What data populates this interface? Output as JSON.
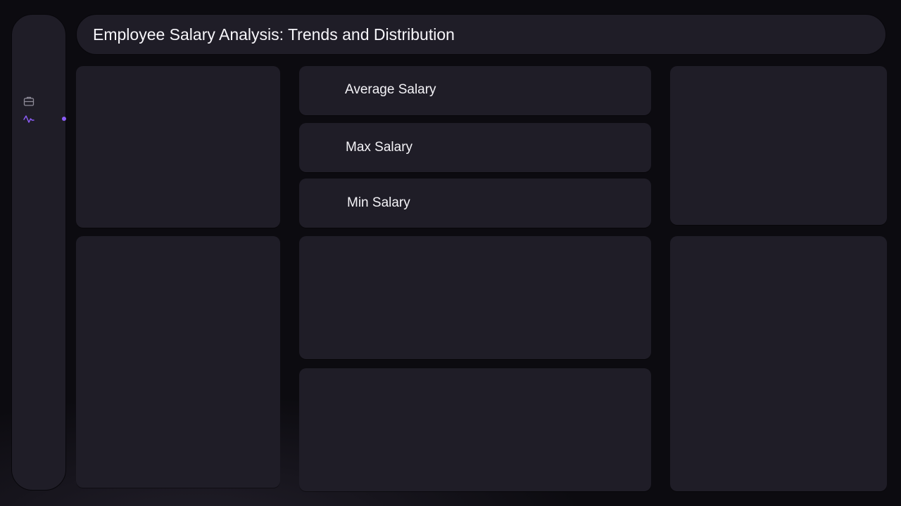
{
  "header": {
    "title": "Employee Salary Analysis: Trends and Distribution"
  },
  "sidebar": {
    "items": [
      {
        "icon": "briefcase-icon",
        "active": false
      },
      {
        "icon": "activity-icon",
        "active": true
      }
    ],
    "accent_color": "#8b5cf6",
    "icon_color": "#8e8b98"
  },
  "stats": [
    {
      "label": "Average Salary"
    },
    {
      "label": "Max Salary"
    },
    {
      "label": "Min Salary"
    }
  ],
  "colors": {
    "background": "#0c0b10",
    "panel": "#1f1d27",
    "text": "#f4f3f7"
  }
}
